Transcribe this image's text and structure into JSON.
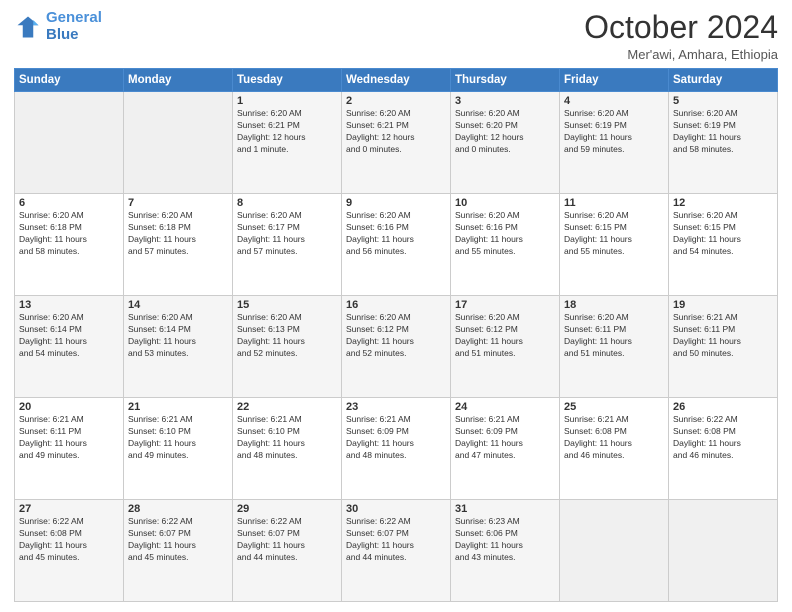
{
  "header": {
    "logo_line1": "General",
    "logo_line2": "Blue",
    "month_title": "October 2024",
    "location": "Mer'awi, Amhara, Ethiopia"
  },
  "days_of_week": [
    "Sunday",
    "Monday",
    "Tuesday",
    "Wednesday",
    "Thursday",
    "Friday",
    "Saturday"
  ],
  "weeks": [
    [
      {
        "day": "",
        "info": ""
      },
      {
        "day": "",
        "info": ""
      },
      {
        "day": "1",
        "info": "Sunrise: 6:20 AM\nSunset: 6:21 PM\nDaylight: 12 hours\nand 1 minute."
      },
      {
        "day": "2",
        "info": "Sunrise: 6:20 AM\nSunset: 6:21 PM\nDaylight: 12 hours\nand 0 minutes."
      },
      {
        "day": "3",
        "info": "Sunrise: 6:20 AM\nSunset: 6:20 PM\nDaylight: 12 hours\nand 0 minutes."
      },
      {
        "day": "4",
        "info": "Sunrise: 6:20 AM\nSunset: 6:19 PM\nDaylight: 11 hours\nand 59 minutes."
      },
      {
        "day": "5",
        "info": "Sunrise: 6:20 AM\nSunset: 6:19 PM\nDaylight: 11 hours\nand 58 minutes."
      }
    ],
    [
      {
        "day": "6",
        "info": "Sunrise: 6:20 AM\nSunset: 6:18 PM\nDaylight: 11 hours\nand 58 minutes."
      },
      {
        "day": "7",
        "info": "Sunrise: 6:20 AM\nSunset: 6:18 PM\nDaylight: 11 hours\nand 57 minutes."
      },
      {
        "day": "8",
        "info": "Sunrise: 6:20 AM\nSunset: 6:17 PM\nDaylight: 11 hours\nand 57 minutes."
      },
      {
        "day": "9",
        "info": "Sunrise: 6:20 AM\nSunset: 6:16 PM\nDaylight: 11 hours\nand 56 minutes."
      },
      {
        "day": "10",
        "info": "Sunrise: 6:20 AM\nSunset: 6:16 PM\nDaylight: 11 hours\nand 55 minutes."
      },
      {
        "day": "11",
        "info": "Sunrise: 6:20 AM\nSunset: 6:15 PM\nDaylight: 11 hours\nand 55 minutes."
      },
      {
        "day": "12",
        "info": "Sunrise: 6:20 AM\nSunset: 6:15 PM\nDaylight: 11 hours\nand 54 minutes."
      }
    ],
    [
      {
        "day": "13",
        "info": "Sunrise: 6:20 AM\nSunset: 6:14 PM\nDaylight: 11 hours\nand 54 minutes."
      },
      {
        "day": "14",
        "info": "Sunrise: 6:20 AM\nSunset: 6:14 PM\nDaylight: 11 hours\nand 53 minutes."
      },
      {
        "day": "15",
        "info": "Sunrise: 6:20 AM\nSunset: 6:13 PM\nDaylight: 11 hours\nand 52 minutes."
      },
      {
        "day": "16",
        "info": "Sunrise: 6:20 AM\nSunset: 6:12 PM\nDaylight: 11 hours\nand 52 minutes."
      },
      {
        "day": "17",
        "info": "Sunrise: 6:20 AM\nSunset: 6:12 PM\nDaylight: 11 hours\nand 51 minutes."
      },
      {
        "day": "18",
        "info": "Sunrise: 6:20 AM\nSunset: 6:11 PM\nDaylight: 11 hours\nand 51 minutes."
      },
      {
        "day": "19",
        "info": "Sunrise: 6:21 AM\nSunset: 6:11 PM\nDaylight: 11 hours\nand 50 minutes."
      }
    ],
    [
      {
        "day": "20",
        "info": "Sunrise: 6:21 AM\nSunset: 6:11 PM\nDaylight: 11 hours\nand 49 minutes."
      },
      {
        "day": "21",
        "info": "Sunrise: 6:21 AM\nSunset: 6:10 PM\nDaylight: 11 hours\nand 49 minutes."
      },
      {
        "day": "22",
        "info": "Sunrise: 6:21 AM\nSunset: 6:10 PM\nDaylight: 11 hours\nand 48 minutes."
      },
      {
        "day": "23",
        "info": "Sunrise: 6:21 AM\nSunset: 6:09 PM\nDaylight: 11 hours\nand 48 minutes."
      },
      {
        "day": "24",
        "info": "Sunrise: 6:21 AM\nSunset: 6:09 PM\nDaylight: 11 hours\nand 47 minutes."
      },
      {
        "day": "25",
        "info": "Sunrise: 6:21 AM\nSunset: 6:08 PM\nDaylight: 11 hours\nand 46 minutes."
      },
      {
        "day": "26",
        "info": "Sunrise: 6:22 AM\nSunset: 6:08 PM\nDaylight: 11 hours\nand 46 minutes."
      }
    ],
    [
      {
        "day": "27",
        "info": "Sunrise: 6:22 AM\nSunset: 6:08 PM\nDaylight: 11 hours\nand 45 minutes."
      },
      {
        "day": "28",
        "info": "Sunrise: 6:22 AM\nSunset: 6:07 PM\nDaylight: 11 hours\nand 45 minutes."
      },
      {
        "day": "29",
        "info": "Sunrise: 6:22 AM\nSunset: 6:07 PM\nDaylight: 11 hours\nand 44 minutes."
      },
      {
        "day": "30",
        "info": "Sunrise: 6:22 AM\nSunset: 6:07 PM\nDaylight: 11 hours\nand 44 minutes."
      },
      {
        "day": "31",
        "info": "Sunrise: 6:23 AM\nSunset: 6:06 PM\nDaylight: 11 hours\nand 43 minutes."
      },
      {
        "day": "",
        "info": ""
      },
      {
        "day": "",
        "info": ""
      }
    ]
  ]
}
